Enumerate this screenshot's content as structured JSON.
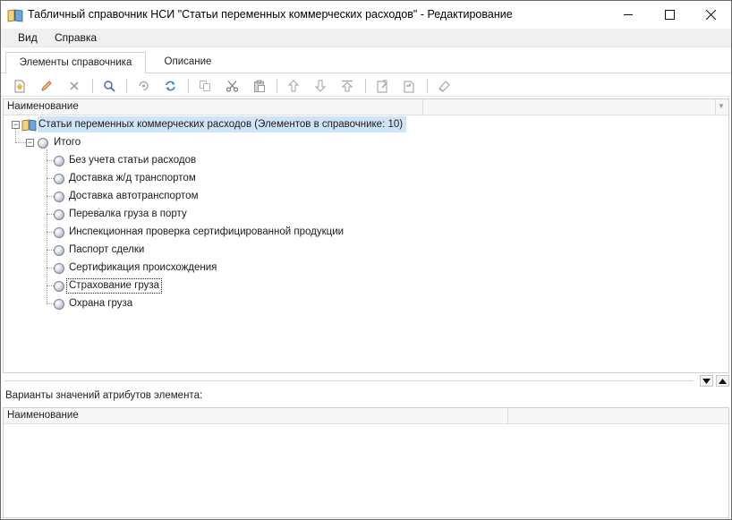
{
  "window": {
    "title": "Табличный справочник НСИ \"Статьи переменных коммерческих расходов\" - Редактирование",
    "icon": "book-icon",
    "controls": {
      "minimize": "─",
      "maximize": "☐",
      "close": "✕"
    }
  },
  "menu": [
    {
      "label": "Вид"
    },
    {
      "label": "Справка"
    }
  ],
  "tabs": [
    {
      "label": "Элементы справочника",
      "active": true
    },
    {
      "label": "Описание",
      "active": false
    }
  ],
  "toolbar": {
    "buttons": [
      "new-element-icon",
      "edit-pencil-icon",
      "delete-x-icon",
      "search-icon",
      "refresh-link-icon",
      "refresh-icon",
      "copy-icon",
      "cut-icon",
      "paste-icon",
      "move-up-icon",
      "move-down-icon",
      "move-top-icon",
      "import-icon",
      "export-icon",
      "eraser-icon"
    ]
  },
  "tree": {
    "column_header": "Наименование",
    "root": {
      "label": "Статьи переменных коммерческих расходов (Элементов в справочнике: 10)",
      "selected": true,
      "expanded": true
    },
    "group": {
      "label": "Итого",
      "expanded": true
    },
    "items": [
      {
        "label": "Без учета статьи расходов"
      },
      {
        "label": "Доставка ж/д транспортом"
      },
      {
        "label": "Доставка автотранспортом"
      },
      {
        "label": "Перевалка груза в порту"
      },
      {
        "label": "Инспекционная проверка сертифицированной продукции"
      },
      {
        "label": "Паспорт сделки"
      },
      {
        "label": "Сертификация происхождения"
      },
      {
        "label": "Страхование груза",
        "focused": true
      },
      {
        "label": "Охрана груза"
      }
    ],
    "expander_symbol": "−"
  },
  "attributes": {
    "label": "Варианты значений атрибутов элемента:",
    "column_header": "Наименование"
  },
  "colors": {
    "selection": "#cfe5f7",
    "header_bg": "#f7f7f7",
    "menubar_bg": "#f0f0f0"
  }
}
